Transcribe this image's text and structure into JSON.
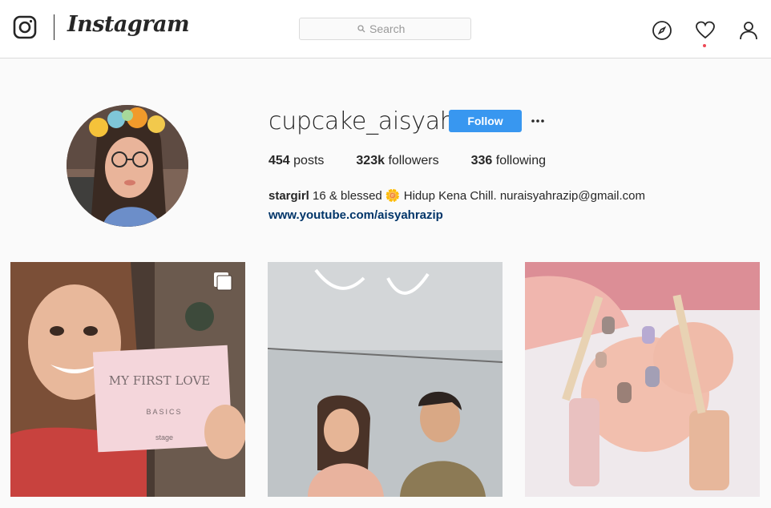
{
  "header": {
    "brand": "Instagram",
    "search": {
      "placeholder": "Search"
    }
  },
  "profile": {
    "username": "cupcake_aisyah",
    "follow_label": "Follow",
    "stats": [
      {
        "value": "454",
        "label": "posts"
      },
      {
        "value": "323k",
        "label": "followers"
      },
      {
        "value": "336",
        "label": "following"
      }
    ],
    "bio": {
      "name": "stargirl",
      "text": "16 & blessed 🌼 Hidup Kena Chill. nuraisyahrazip@gmail.com",
      "link": "www.youtube.com/aisyahrazip"
    }
  },
  "posts": [
    {
      "overlay_title": "MY FIRST LOVE",
      "overlay_sub": "BASICS",
      "overlay_brand": "stage",
      "multi": true
    },
    {
      "multi": false
    },
    {
      "multi": false
    }
  ],
  "colors": {
    "accent": "#3897f0",
    "notification": "#ed4956",
    "link": "#003569"
  },
  "icons": [
    "instagram-glyph-icon",
    "search-icon",
    "explore-compass-icon",
    "heart-icon",
    "person-icon",
    "more-options-icon",
    "multiple-photos-icon"
  ]
}
